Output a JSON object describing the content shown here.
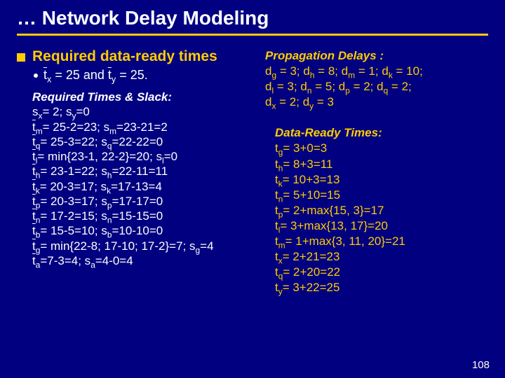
{
  "title": "… Network Delay Modeling",
  "bullet": "Required data-ready times",
  "subbullet_pre": "t",
  "subbullet_x": "x",
  "subbullet_mid1": " = 25 and ",
  "subbullet_t2": "t",
  "subbullet_y": "y",
  "subbullet_end": " = 25.",
  "left": {
    "heading": "Required Times & Slack:",
    "l1a": "s",
    "l1b": "x",
    "l1c": "= 2; s",
    "l1d": "y",
    "l1e": "=0",
    "l2a": "t",
    "l2b": "m",
    "l2c": "= 25-2=23; s",
    "l2d": "m",
    "l2e": "=23-21=2",
    "l3a": "t",
    "l3b": "q",
    "l3c": "= 25-3=22; s",
    "l3d": "q",
    "l3e": "=22-22=0",
    "l4a": "t",
    "l4b": "l",
    "l4c": "= min{23-1, 22-2}=20; s",
    "l4d": "l",
    "l4e": "=0",
    "l5a": "t",
    "l5b": "h",
    "l5c": "= 23-1=22; s",
    "l5d": "h",
    "l5e": "=22-11=11",
    "l6a": "t",
    "l6b": "k",
    "l6c": "= 20-3=17; s",
    "l6d": "k",
    "l6e": "=17-13=4",
    "l7a": "t",
    "l7b": "p",
    "l7c": "= 20-3=17; s",
    "l7d": "p",
    "l7e": "=17-17=0",
    "l8a": "t",
    "l8b": "n",
    "l8c": "= 17-2=15; s",
    "l8d": "n",
    "l8e": "=15-15=0",
    "l9a": "t",
    "l9b": "b",
    "l9c": "= 15-5=10; s",
    "l9d": "b",
    "l9e": "=10-10=0",
    "l10a": "t",
    "l10b": "g",
    "l10c": "= min{22-8; 17-10; 17-2}=7; s",
    "l10d": "g",
    "l10e": "=4",
    "l11a": "t",
    "l11b": "a",
    "l11c": "=7-3=4; s",
    "l11d": "a",
    "l11e": "=4-0=4"
  },
  "right": {
    "heading": "Propagation Delays :",
    "p1": "d",
    "p1s": "g",
    "p1t": " = 3; d",
    "p2s": "h",
    "p2t": " = 8; d",
    "p3s": "m",
    "p3t": " = 1; d",
    "p4s": "k",
    "p4t": " = 10;",
    "p5": "d",
    "p5s": "l",
    "p5t": " = 3; d",
    "p6s": "n",
    "p6t": " = 5; d",
    "p7s": "p",
    "p7t": " = 2; d",
    "p8s": "q",
    "p8t": " = 2;",
    "p9": "d",
    "p9s": "x",
    "p9t": " = 2; d",
    "p10s": "y",
    "p10t": " = 3",
    "dr_heading": "Data-Ready Times:",
    "d1": "t",
    "d1s": "g",
    "d1t": "= 3+0=3",
    "d2": "t",
    "d2s": "h",
    "d2t": "= 8+3=11",
    "d3": "t",
    "d3s": "k",
    "d3t": "= 10+3=13",
    "d4": "t",
    "d4s": "n",
    "d4t": "= 5+10=15",
    "d5": "t",
    "d5s": "p",
    "d5t": "= 2+max{15, 3}=17",
    "d6": "t",
    "d6s": "l",
    "d6t": "= 3+max{13, 17}=20",
    "d7": "t",
    "d7s": "m",
    "d7t": "= 1+max{3, 11, 20}=21",
    "d8": "t",
    "d8s": "x",
    "d8t": "= 2+21=23",
    "d9": "t",
    "d9s": "q",
    "d9t": "= 2+20=22",
    "d10": "t",
    "d10s": "y",
    "d10t": "= 3+22=25"
  },
  "page": "108"
}
